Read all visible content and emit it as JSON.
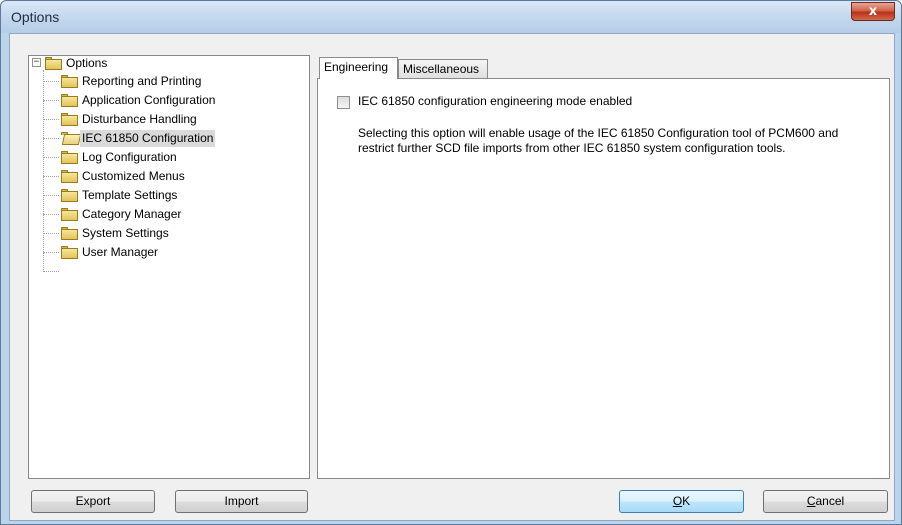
{
  "window": {
    "title": "Options",
    "close_glyph": "x"
  },
  "tree": {
    "root": {
      "label": "Options",
      "expander": "−",
      "icon": "folder-icon"
    },
    "items": [
      {
        "label": "Reporting and Printing",
        "icon": "folder-icon"
      },
      {
        "label": "Application Configuration",
        "icon": "folder-icon"
      },
      {
        "label": "Disturbance Handling",
        "icon": "folder-icon"
      },
      {
        "label": "IEC 61850 Configuration",
        "icon": "folder-open-icon",
        "selected": true
      },
      {
        "label": "Log Configuration",
        "icon": "folder-icon"
      },
      {
        "label": "Customized Menus",
        "icon": "folder-icon"
      },
      {
        "label": "Template Settings",
        "icon": "folder-icon"
      },
      {
        "label": "Category Manager",
        "icon": "folder-icon"
      },
      {
        "label": "System Settings",
        "icon": "folder-icon"
      },
      {
        "label": "User Manager",
        "icon": "folder-icon"
      }
    ]
  },
  "tabs": [
    {
      "label": "Engineering",
      "active": true
    },
    {
      "label": "Miscellaneous",
      "active": false
    }
  ],
  "engineering": {
    "checkbox_label": "IEC 61850 configuration engineering mode enabled",
    "checkbox_checked": false,
    "description_line1": "Selecting this option will enable usage of the IEC 61850 Configuration tool of PCM600 and",
    "description_line2": "restrict further SCD file imports from other IEC 61850 system configuration tools."
  },
  "buttons": {
    "export": "Export",
    "import": "Import",
    "ok_accel": "O",
    "ok_rest": "K",
    "cancel_accel": "C",
    "cancel_rest": "ancel"
  }
}
